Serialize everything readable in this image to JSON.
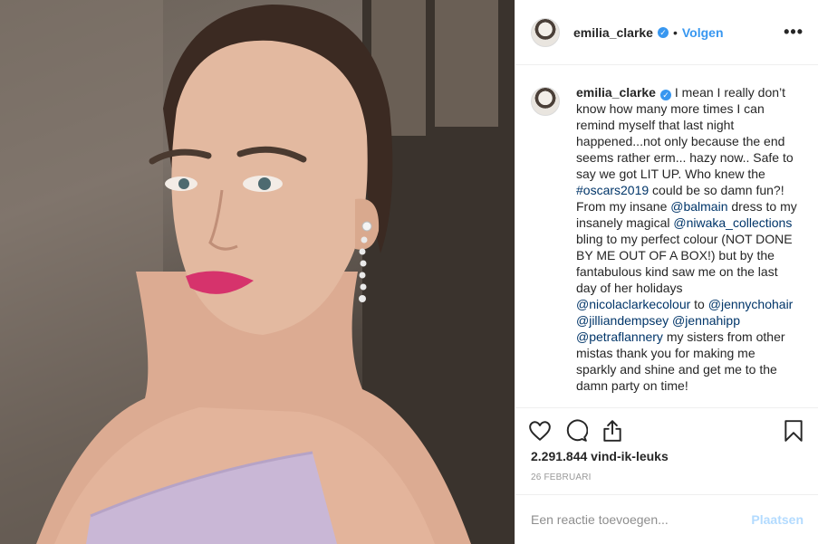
{
  "post": {
    "image_alt": "Portrait photo of a woman with slicked-back hair, pink lipstick and drop earrings",
    "colors": {
      "skin": "#e3b9a0",
      "lips": "#d6336c",
      "hair": "#3b2a22",
      "dress": "#c9b7d6"
    }
  },
  "header": {
    "username": "emilia_clarke",
    "verified_icon": "verified-badge-icon",
    "separator": "•",
    "follow_label": "Volgen",
    "more_label": "•••"
  },
  "caption": {
    "username": "emilia_clarke",
    "text_1": " I mean I really don’t know how many more times I can remind myself that last night happened...not only because the end seems rather erm... hazy now.. Safe to say we got LIT UP. Who knew the ",
    "hashtag_1": "#oscars2019",
    "text_2": " could be so damn fun?! From my insane ",
    "mention_1": "@balmain",
    "text_3": " dress to my insanely magical ",
    "mention_2": "@niwaka_collections",
    "text_4": " bling to my perfect colour (NOT DONE BY ME OUT OF A BOX!) but by the fantabulous kind saw me on the last day of her holidays ",
    "mention_3": "@nicolaclarkecolour",
    "text_5": " to ",
    "mention_4": "@jennychohair",
    "text_6": " ",
    "mention_5": "@jilliandempsey",
    "text_7": " ",
    "mention_6": "@jennahipp",
    "text_8": " ",
    "mention_7": "@petraflannery",
    "text_9": " my sisters from other mistas thank you for making me sparkly and shine and get me to the damn party on time!"
  },
  "actions": {
    "like_icon": "heart-icon",
    "comment_icon": "comment-icon",
    "share_icon": "share-icon",
    "save_icon": "bookmark-icon"
  },
  "stats": {
    "likes": "2.291.844 vind-ik-leuks",
    "date": "26 FEBRUARI"
  },
  "comment_input": {
    "placeholder": "Een reactie toevoegen...",
    "post_label": "Plaatsen"
  }
}
